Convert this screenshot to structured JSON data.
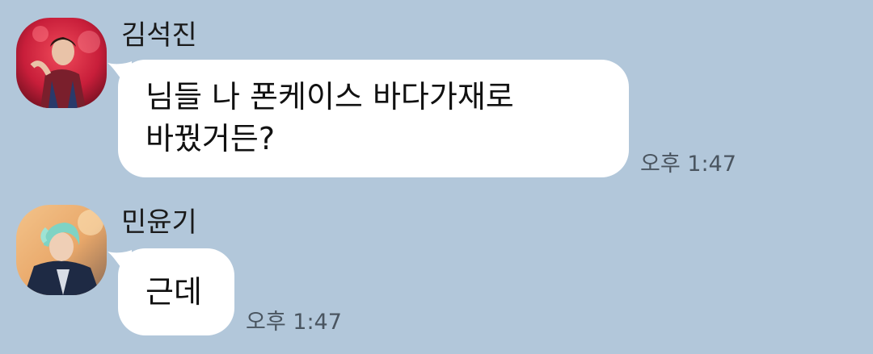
{
  "chat": {
    "background": "#b2c7da",
    "messages": [
      {
        "sender": "김석진",
        "lines": [
          "님들 나 폰케이스 바다가재로",
          "바꿨거든?"
        ],
        "time": "오후 1:47"
      },
      {
        "sender": "민윤기",
        "lines": [
          "근데"
        ],
        "time": "오후 1:47"
      }
    ]
  }
}
